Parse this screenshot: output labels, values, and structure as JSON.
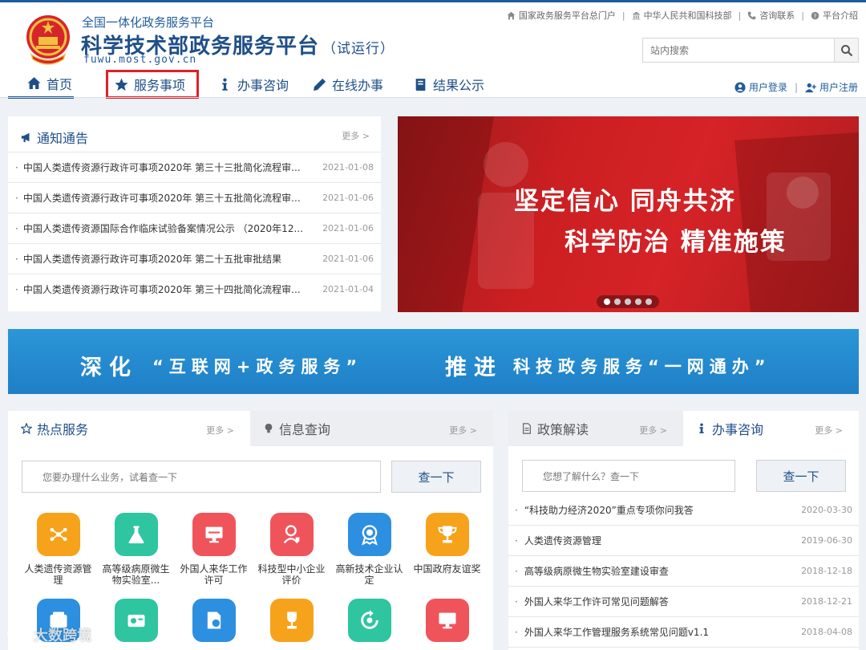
{
  "header": {
    "subtitle": "全国一体化政务服务平台",
    "title": "科学技术部政务服务平台",
    "trial": "（试运行）",
    "domain": "fuwu.most.gov.cn",
    "toplinks": [
      "国家政务服务平台总门户",
      "中华人民共和国科技部",
      "咨询联系",
      "平台介绍"
    ],
    "search_placeholder": "站内搜索",
    "user_login": "用户登录",
    "user_register": "用户注册"
  },
  "nav": [
    {
      "label": "首页",
      "icon": "home-icon"
    },
    {
      "label": "服务事项",
      "icon": "star-icon"
    },
    {
      "label": "办事咨询",
      "icon": "info-icon"
    },
    {
      "label": "在线办事",
      "icon": "pencil-icon"
    },
    {
      "label": "结果公示",
      "icon": "book-icon"
    }
  ],
  "notice": {
    "title": "通知通告",
    "more": "更多 >",
    "items": [
      {
        "title": "中国人类遗传资源行政许可事项2020年 第三十三批简化流程审...",
        "date": "2021-01-08"
      },
      {
        "title": "中国人类遗传资源行政许可事项2020年 第三十五批简化流程审...",
        "date": "2021-01-06"
      },
      {
        "title": "中国人类遗传资源国际合作临床试验备案情况公示 （2020年12...",
        "date": "2021-01-06"
      },
      {
        "title": "中国人类遗传资源行政许可事项2020年 第二十五批审批结果",
        "date": "2021-01-06"
      },
      {
        "title": "中国人类遗传资源行政许可事项2020年 第三十四批简化流程审...",
        "date": "2021-01-04"
      }
    ]
  },
  "banner": {
    "line1": "坚定信心  同舟共济",
    "line2": "科学防治  精准施策"
  },
  "slogan": {
    "a": "深化",
    "b": "“互联网+政务服务”",
    "c": "推进",
    "d": "科技政务服务“一网通办”"
  },
  "services": {
    "tab_hot": "热点服务",
    "tab_info": "信息查询",
    "more": "更多 >",
    "query_placeholder": "您要办理什么业务，试着查一下",
    "query_button": "查一下",
    "items": [
      {
        "label": "人类遗传资源管理",
        "color": "#f7a21b",
        "icon": "molecule-icon"
      },
      {
        "label": "高等级病原微生物实验室...",
        "color": "#2ec5a0",
        "icon": "flask-icon"
      },
      {
        "label": "外国人来华工作许可",
        "color": "#f0545b",
        "icon": "monitor-icon"
      },
      {
        "label": "科技型中小企业评价",
        "color": "#f0545b",
        "icon": "person-icon"
      },
      {
        "label": "高新技术企业认定",
        "color": "#2d8fe0",
        "icon": "badge-icon"
      },
      {
        "label": "中国政府友谊奖",
        "color": "#f7a21b",
        "icon": "trophy-icon"
      },
      {
        "label": "",
        "color": "#2d8fe0",
        "icon": "folder-icon"
      },
      {
        "label": "",
        "color": "#2ec5a0",
        "icon": "money-icon"
      },
      {
        "label": "",
        "color": "#2d8fe0",
        "icon": "finance-doc-icon"
      },
      {
        "label": "",
        "color": "#f7a21b",
        "icon": "trophy-icon"
      },
      {
        "label": "",
        "color": "#2ec5a0",
        "icon": "refresh-icon"
      },
      {
        "label": "",
        "color": "#f0545b",
        "icon": "monitor-icon"
      }
    ]
  },
  "policy": {
    "tab_policy": "政策解读",
    "tab_consult": "办事咨询",
    "more": "更多 >",
    "query_placeholder": "您想了解什么？查一下",
    "query_button": "查一下",
    "items": [
      {
        "title": "“科技助力经济2020”重点专项你问我答",
        "date": "2020-03-30"
      },
      {
        "title": "人类遗传资源管理",
        "date": "2019-06-30"
      },
      {
        "title": "高等级病原微生物实验室建设审查",
        "date": "2018-12-18"
      },
      {
        "title": "外国人来华工作许可常见问题解答",
        "date": "2018-12-21"
      },
      {
        "title": "外国人来华工作管理服务系统常见问题v1.1",
        "date": "2018-04-08"
      }
    ]
  },
  "watermark": "大数跨境"
}
